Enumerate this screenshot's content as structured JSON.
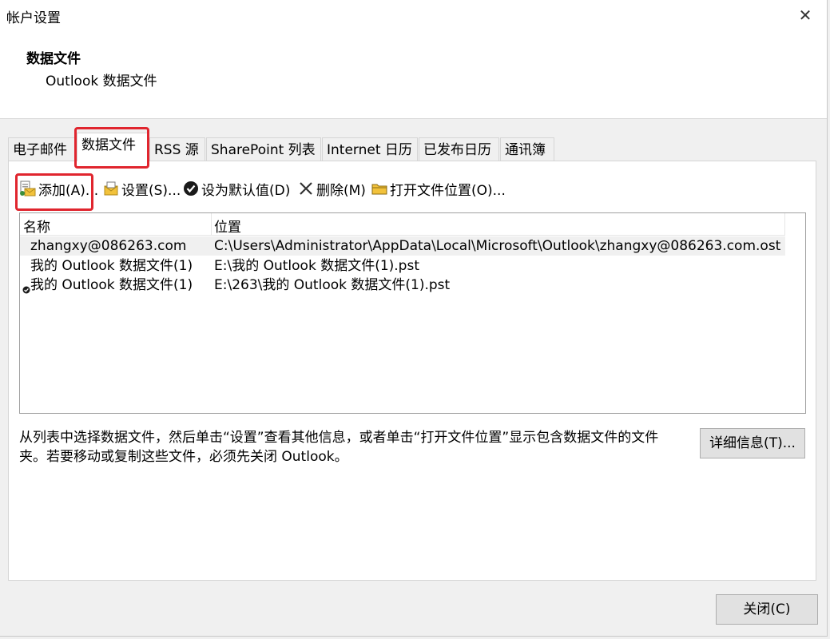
{
  "window": {
    "title": "帐户设置",
    "close_symbol": "✕"
  },
  "header": {
    "title": "数据文件",
    "subtitle": "Outlook 数据文件"
  },
  "tabs": [
    {
      "label": "电子邮件",
      "active": false
    },
    {
      "label": "数据文件",
      "active": true
    },
    {
      "label": "RSS 源",
      "active": false
    },
    {
      "label": "SharePoint 列表",
      "active": false
    },
    {
      "label": "Internet 日历",
      "active": false
    },
    {
      "label": "已发布日历",
      "active": false
    },
    {
      "label": "通讯簿",
      "active": false
    }
  ],
  "toolbar": {
    "add_label": "添加(A)...",
    "settings_label": "设置(S)...",
    "default_label": "设为默认值(D)",
    "delete_label": "删除(M)",
    "open_location_label": "打开文件位置(O)..."
  },
  "list": {
    "columns": [
      "名称",
      "位置"
    ],
    "rows": [
      {
        "name": "zhangxy@086263.com",
        "location": "C:\\Users\\Administrator\\AppData\\Local\\Microsoft\\Outlook\\zhangxy@086263.com.ost",
        "selected": true,
        "default": false
      },
      {
        "name": "我的 Outlook 数据文件(1)",
        "location": "E:\\我的 Outlook 数据文件(1).pst",
        "selected": false,
        "default": false
      },
      {
        "name": "我的 Outlook 数据文件(1)",
        "location": "E:\\263\\我的 Outlook 数据文件(1).pst",
        "selected": false,
        "default": true
      }
    ]
  },
  "info": {
    "text": "从列表中选择数据文件，然后单击“设置”查看其他信息，或者单击“打开文件位置”显示包含数据文件的文件夹。若要移动或复制这些文件，必须先关闭 Outlook。"
  },
  "buttons": {
    "details_label": "详细信息(T)...",
    "close_label": "关闭(C)"
  },
  "colors": {
    "highlight": "#e0252e",
    "selected_row": "#f0f0f0"
  }
}
